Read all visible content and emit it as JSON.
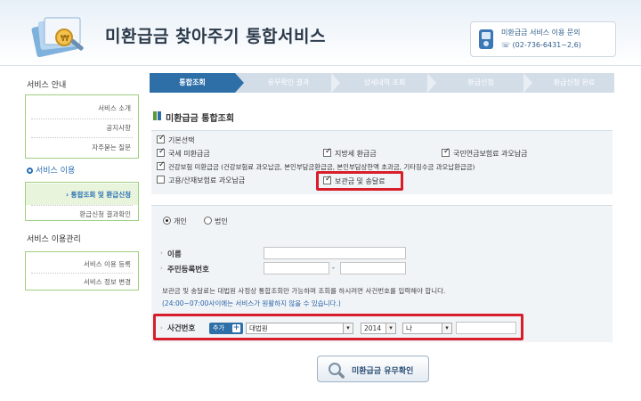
{
  "header": {
    "title": "미환급금 찾아주기 통합서비스",
    "contact_title": "미환급금 서비스 이용 문의",
    "contact_phone": "(02-736-6431~2,6)"
  },
  "sidebar": {
    "service_info_heading": "서비스 안내",
    "service_info_items": [
      {
        "label": "서비스 소개"
      },
      {
        "label": "공지사항"
      },
      {
        "label": "자주묻는 질문"
      }
    ],
    "service_use_heading": "서비스 이용",
    "service_use_items": [
      {
        "label": "통합조회 및 환급신청",
        "active": true
      },
      {
        "label": "환급신청 결과확인"
      }
    ],
    "service_manage_heading": "서비스 이용관리",
    "service_manage_items": [
      {
        "label": "서비스 이용 등록"
      },
      {
        "label": "서비스 정보 변경"
      }
    ]
  },
  "steps": [
    {
      "label": "통합조회",
      "active": true
    },
    {
      "label": "유무확인 결과"
    },
    {
      "label": "상세내역 조회"
    },
    {
      "label": "환급신청"
    },
    {
      "label": "환급신청 완료"
    }
  ],
  "section_title": "미환급금 통합조회",
  "options": {
    "basic_select": {
      "label": "기본선택",
      "checked": true
    },
    "national_tax": {
      "label": "국세 미환급금",
      "checked": true
    },
    "local_tax": {
      "label": "지방세 환급금",
      "checked": true
    },
    "national_pension": {
      "label": "국민연금보험료 과오납금",
      "checked": true
    },
    "health_insurance": {
      "label": "건강보험 미환급금 (건강보험료 과오납금, 본인부담금환급금, 본인부담상한액 초과금, 기타징수금 과오납환급금)",
      "checked": true
    },
    "employment_insurance": {
      "label": "고용/산재보험료 과오납금",
      "checked": false
    },
    "deposit_fee": {
      "label": "보관금 및 송달료",
      "checked": true
    }
  },
  "form": {
    "person_type": [
      {
        "label": "개인",
        "selected": true
      },
      {
        "label": "법인",
        "selected": false
      }
    ],
    "name_label": "이름",
    "name_value": "",
    "rrn_label": "주민등록번호",
    "rrn_separator": "-",
    "note_line1": "보관금 및 송달료는 대법원 사정상 통합조회만 가능하며 조회를 하시려면 사건번호를 입력해야 합니다.",
    "note_line2": "(24:00~07:00사이에는 서비스가 원활하지 않을 수 있습니다.)",
    "case_label": "사건번호",
    "add_button": "추가",
    "court_select": "대법원",
    "year_select": "2014",
    "type_select": "나",
    "case_number_value": ""
  },
  "confirm_button": "미환급금 유무확인",
  "colors": {
    "accent_blue": "#2e6fa8",
    "highlight_red": "#d81e2a",
    "sidebar_green": "#9fcf7f"
  }
}
